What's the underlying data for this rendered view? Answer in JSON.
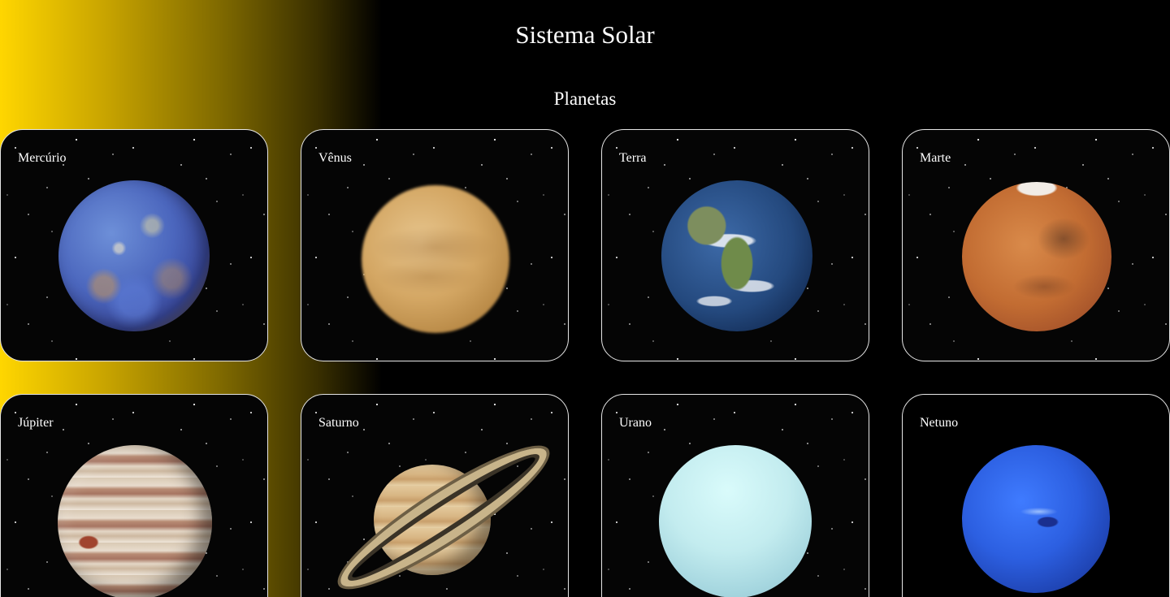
{
  "page": {
    "title": "Sistema Solar",
    "section_title": "Planetas"
  },
  "planets": [
    {
      "name": "Mercúrio",
      "icon": "mercury-image"
    },
    {
      "name": "Vênus",
      "icon": "venus-image"
    },
    {
      "name": "Terra",
      "icon": "earth-image"
    },
    {
      "name": "Marte",
      "icon": "mars-image"
    },
    {
      "name": "Júpiter",
      "icon": "jupiter-image"
    },
    {
      "name": "Saturno",
      "icon": "saturn-image"
    },
    {
      "name": "Urano",
      "icon": "uranus-image"
    },
    {
      "name": "Netuno",
      "icon": "neptune-image"
    }
  ],
  "colors": {
    "sun_gradient_start": "#ffd600",
    "background": "#000000",
    "text": "#ffffff",
    "card_border": "#e6e6e6"
  }
}
